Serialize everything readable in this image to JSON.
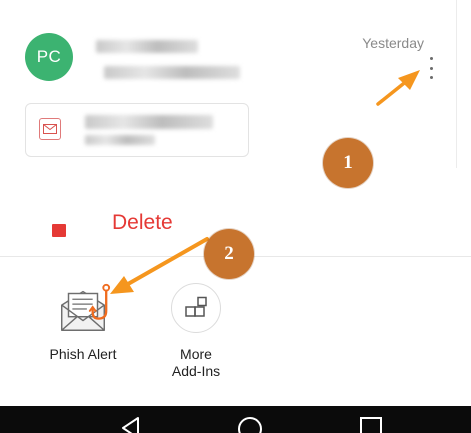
{
  "email": {
    "avatar_initials": "PC",
    "timestamp": "Yesterday",
    "avatar_color": "#3cb371",
    "more_options_icon": "kebab-vertical-icon",
    "attachment_icon": "mail-attachment-icon"
  },
  "annotations": {
    "step_1": "1",
    "step_2": "2",
    "badge_color": "#c7742e",
    "arrow_color": "#f5961e"
  },
  "menu": {
    "delete_label": "Delete",
    "delete_color": "#e53935",
    "delete_icon": "trash-icon"
  },
  "addins": [
    {
      "label": "Phish Alert",
      "icon": "phish-alert-icon"
    },
    {
      "label": "More\nAdd-Ins",
      "icon": "add-ins-grid-icon"
    }
  ],
  "navbar": {
    "buttons": [
      "back-icon",
      "home-icon",
      "recents-icon"
    ]
  }
}
